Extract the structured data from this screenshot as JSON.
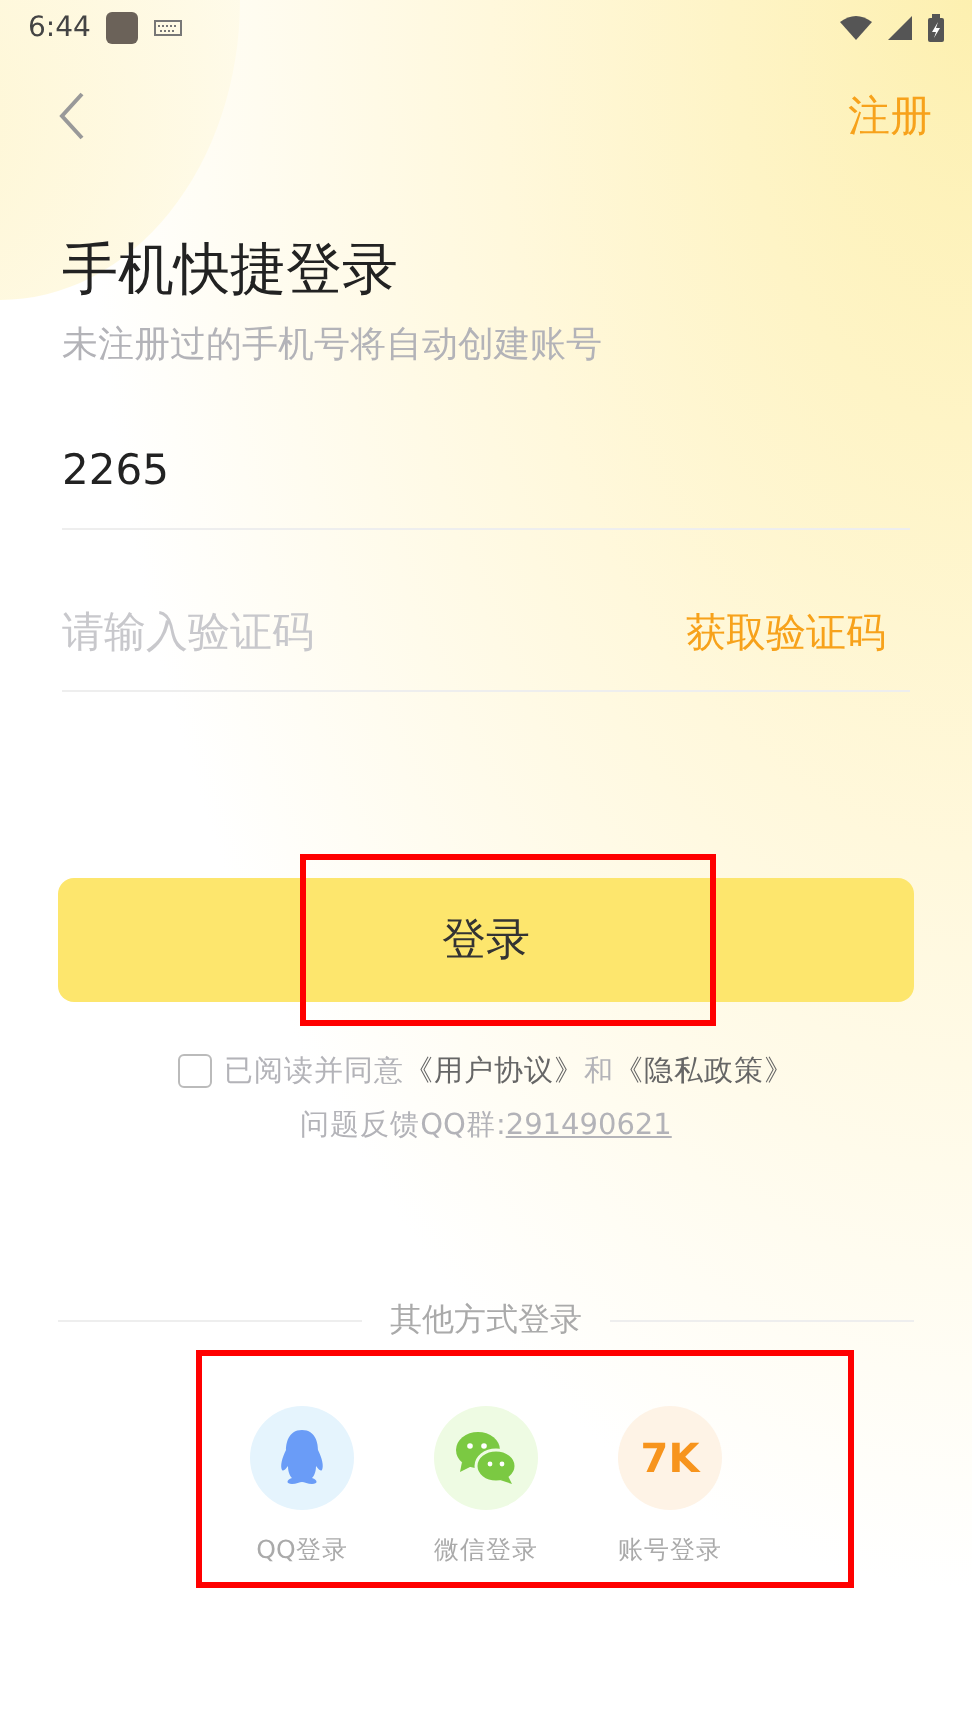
{
  "status_bar": {
    "time": "6:44"
  },
  "header": {
    "action": "注册"
  },
  "title": "手机快捷登录",
  "subtitle": "未注册过的手机号将自动创建账号",
  "phone_field": {
    "value": "2265"
  },
  "code_field": {
    "placeholder": "请输入验证码",
    "action": "获取验证码"
  },
  "login_button": "登录",
  "agreement": {
    "checked": false,
    "parts": [
      {
        "kind": "plain",
        "text": "已阅读并同意"
      },
      {
        "kind": "link",
        "text": "《用户协议》"
      },
      {
        "kind": "plain",
        "text": "和"
      },
      {
        "kind": "link",
        "text": "《隐私政策》"
      }
    ]
  },
  "feedback": {
    "label": "问题反馈QQ群:",
    "group": "291490621"
  },
  "other_logins": {
    "heading": "其他方式登录",
    "items": [
      {
        "kind": "qq",
        "label": "QQ登录"
      },
      {
        "kind": "wechat",
        "label": "微信登录"
      },
      {
        "kind": "account",
        "label": "账号登录",
        "badge": "7K"
      }
    ]
  }
}
